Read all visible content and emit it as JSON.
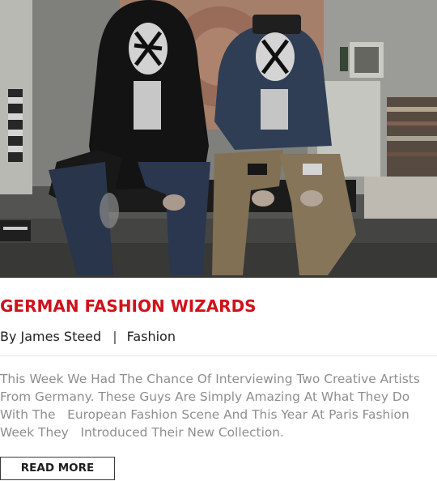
{
  "hero_image": {
    "alt": ""
  },
  "post": {
    "title": "GERMAN FASHION WIZARDS",
    "author_label": "By James Steed",
    "separator": "|",
    "category": "Fashion",
    "excerpt": "This Week We Had The Chance Of Interviewing Two Creative Artists From Germany. These Guys Are Simply Amazing At What They Do With The   European Fashion Scene And This Year At Paris Fashion Week They   Introduced Their New Collection.",
    "read_more_label": "READ MORE"
  },
  "colors": {
    "title": "#d0121b",
    "excerpt": "#8e8e8e",
    "text": "#1f1f1f"
  }
}
